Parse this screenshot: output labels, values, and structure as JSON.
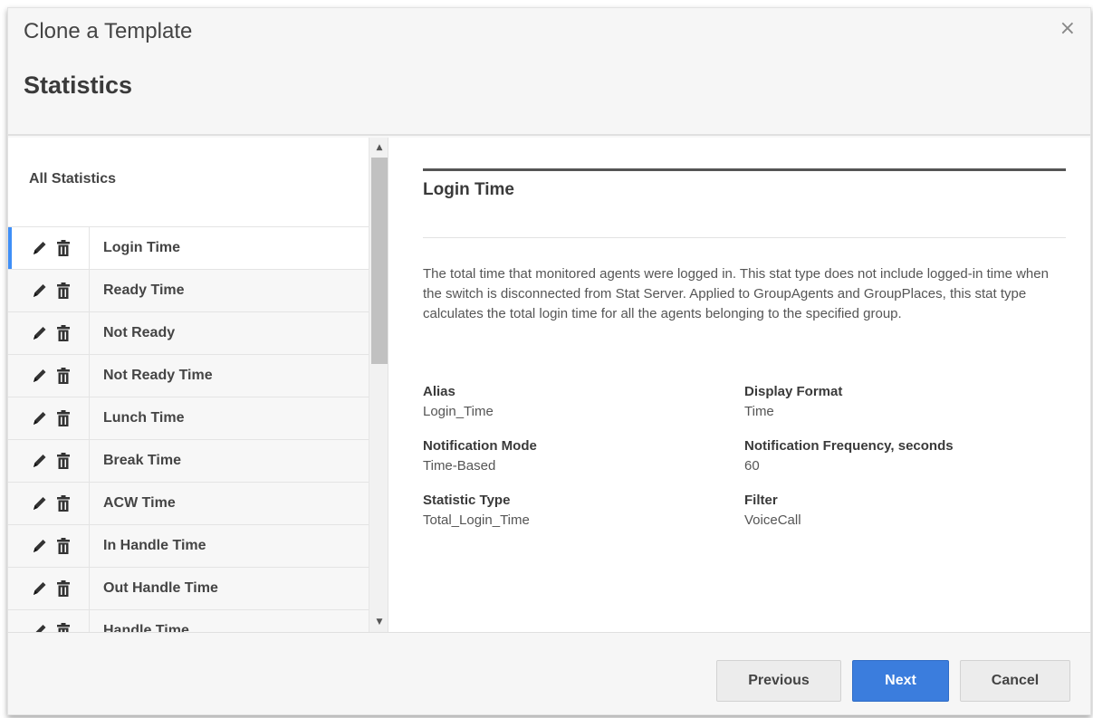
{
  "dialog": {
    "title": "Clone a Template",
    "step_title": "Statistics",
    "close_glyph": "×"
  },
  "list": {
    "heading": "All Statistics",
    "items": [
      {
        "label": "Login Time"
      },
      {
        "label": "Ready Time"
      },
      {
        "label": "Not Ready"
      },
      {
        "label": "Not Ready Time"
      },
      {
        "label": "Lunch Time"
      },
      {
        "label": "Break Time"
      },
      {
        "label": "ACW Time"
      },
      {
        "label": "In Handle Time"
      },
      {
        "label": "Out Handle Time"
      },
      {
        "label": "Handle Time"
      }
    ],
    "selected_index": 0,
    "row_icons": [
      "pencil-icon",
      "trash-icon"
    ]
  },
  "detail": {
    "title": "Login Time",
    "description": "The total time that monitored agents were logged in. This stat type does not include logged-in time when the switch is disconnected from Stat Server. Applied to GroupAgents and GroupPlaces, this stat type calculates the total login time for all the agents belonging to the specified group.",
    "fields": {
      "alias": {
        "label": "Alias",
        "value": "Login_Time"
      },
      "display_format": {
        "label": "Display Format",
        "value": "Time"
      },
      "notification_mode": {
        "label": "Notification Mode",
        "value": "Time-Based"
      },
      "notification_frequency": {
        "label": "Notification Frequency, seconds",
        "value": "60"
      },
      "statistic_type": {
        "label": "Statistic Type",
        "value": "Total_Login_Time"
      },
      "filter": {
        "label": "Filter",
        "value": "VoiceCall"
      }
    }
  },
  "footer": {
    "previous_label": "Previous",
    "next_label": "Next",
    "cancel_label": "Cancel"
  },
  "colors": {
    "accent": "#3b7ddd",
    "selection_bar": "#3f8ff7"
  }
}
